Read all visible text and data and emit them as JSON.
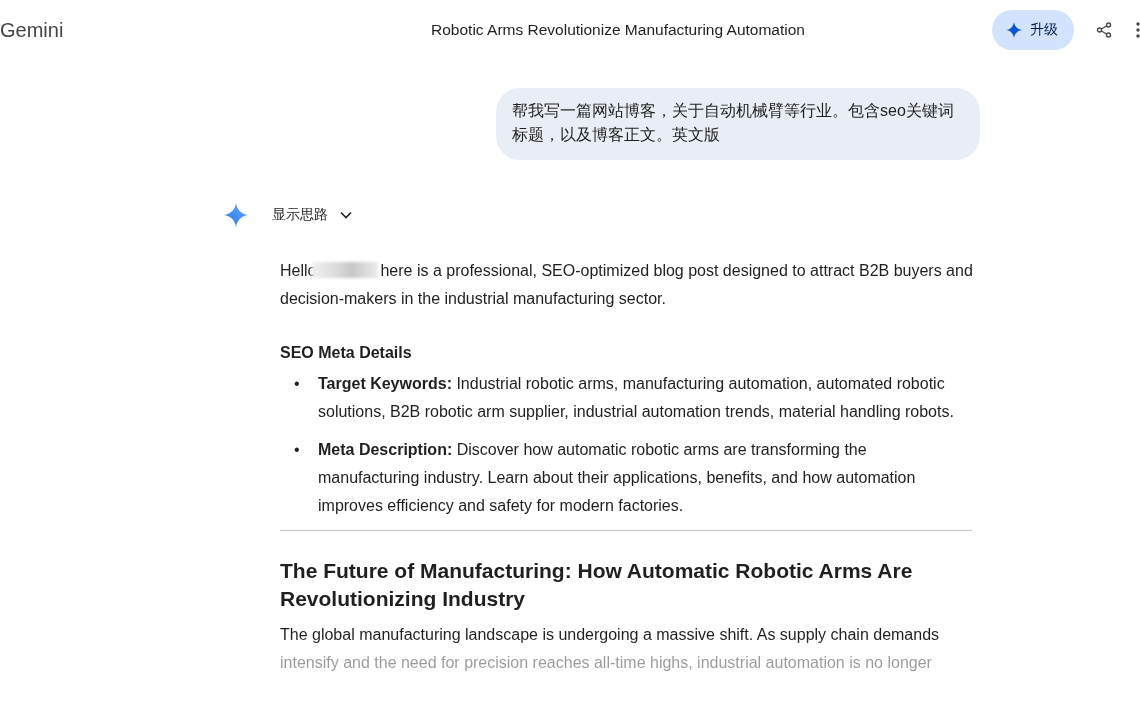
{
  "header": {
    "app_name": "Gemini",
    "title": "Robotic Arms Revolutionize Manufacturing Automation",
    "upgrade_label": "升级"
  },
  "user_message": "帮我写一篇网站博客，关于自动机械臂等行业。包含seo关键词标题，以及博客正文。英文版",
  "thoughts": {
    "label": "显示思路",
    "expanded": false
  },
  "response": {
    "greeting": "Hello",
    "intro": "here is a professional, SEO-optimized blog post designed to attract B2B buyers and decision-makers in the industrial manufacturing sector.",
    "section_title": "SEO Meta Details",
    "bullets": [
      {
        "marker": "•",
        "term": "Target Keywords:",
        "text": "Industrial robotic arms, manufacturing automation, automated robotic solutions, B2B robotic arm supplier, industrial automation trends, material handling robots."
      },
      {
        "marker": "•",
        "term": "Meta Description:",
        "text": "Discover how automatic robotic arms are transforming the manufacturing industry. Learn about their applications, benefits, and how automation improves efficiency and safety for modern factories."
      }
    ],
    "heading": "The Future of Manufacturing: How Automatic Robotic Arms Are Revolutionizing Industry",
    "paragraph": "The global manufacturing landscape is undergoing a massive shift. As supply chain demands intensify and the need for precision reaches all-time highs, industrial automation is no longer"
  }
}
